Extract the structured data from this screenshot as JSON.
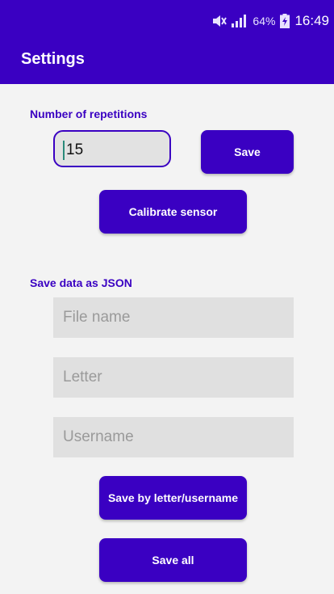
{
  "status_bar": {
    "mute_icon": "muted-speaker-icon",
    "signal_icon": "signal-icon",
    "battery_percent": "64%",
    "battery_icon": "battery-charging-icon",
    "time": "16:49"
  },
  "app_bar": {
    "title": "Settings"
  },
  "repetitions": {
    "label": "Number of repetitions",
    "value": "15",
    "save_label": "Save",
    "calibrate_label": "Calibrate sensor"
  },
  "json_export": {
    "label": "Save data as JSON",
    "file_name_placeholder": "File name",
    "letter_placeholder": "Letter",
    "username_placeholder": "Username",
    "save_by_letter_label": "Save by letter/username",
    "save_all_label": "Save all"
  },
  "colors": {
    "primary": "#3a00c2",
    "field_background": "#e0e0e0",
    "background": "#f3f3f3"
  }
}
